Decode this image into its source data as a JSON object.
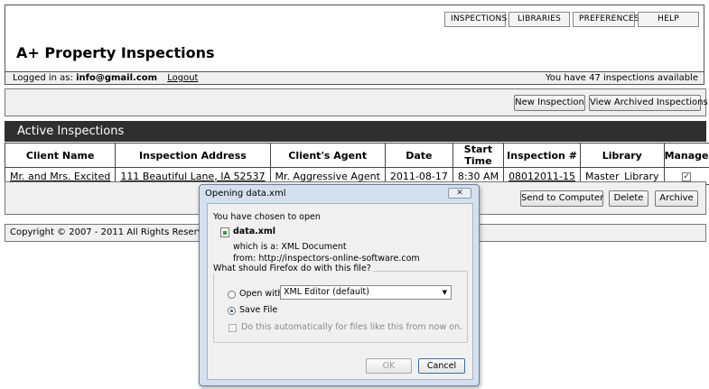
{
  "nav": {
    "inspections": "INSPECTIONS",
    "libraries": "LIBRARIES",
    "preferences": "PREFERENCES",
    "help": "HELP"
  },
  "header": {
    "title": "A+ Property Inspections",
    "logged_in_label": "Logged in as:",
    "user_email": "info@gmail.com",
    "logout": "Logout",
    "inspection_count": "You have 47 inspections available"
  },
  "actions": {
    "new_inspection": "New Inspection",
    "view_archived": "View Archived Inspections"
  },
  "section": {
    "title": "Active Inspections"
  },
  "table": {
    "columns": [
      "Client Name",
      "Inspection Address",
      "Client's Agent",
      "Date",
      "Start Time",
      "Inspection #",
      "Library",
      "Manage"
    ],
    "rows": [
      {
        "client": "Mr. and Mrs. Excited",
        "address": "111 Beautiful Lane, IA 52537",
        "agent": "Mr. Aggressive Agent",
        "date": "2011-08-17",
        "start_time": "8:30 AM",
        "number": "08012011-15",
        "library": "Master_Library",
        "manage_checked": true
      }
    ]
  },
  "bottom_actions": {
    "send": "Send to Computer",
    "delete": "Delete",
    "archive": "Archive"
  },
  "footer": {
    "copyright": "Copyright © 2007 - 2011 All Rights Reserved,"
  },
  "dialog": {
    "title": "Opening data.xml",
    "close": "✕",
    "chosen_to_open": "You have chosen to open",
    "file_name": "data.xml",
    "which_is": "which is a:  XML Document",
    "from": "from:  http://inspectors-online-software.com",
    "question": "What should Firefox do with this file?",
    "open_with_label": "Open with",
    "open_with_value": "XML Editor (default)",
    "save_file_label": "Save File",
    "selected_option": "Save File",
    "auto_label": "Do this automatically for files like this from now on.",
    "ok": "OK",
    "cancel": "Cancel"
  }
}
